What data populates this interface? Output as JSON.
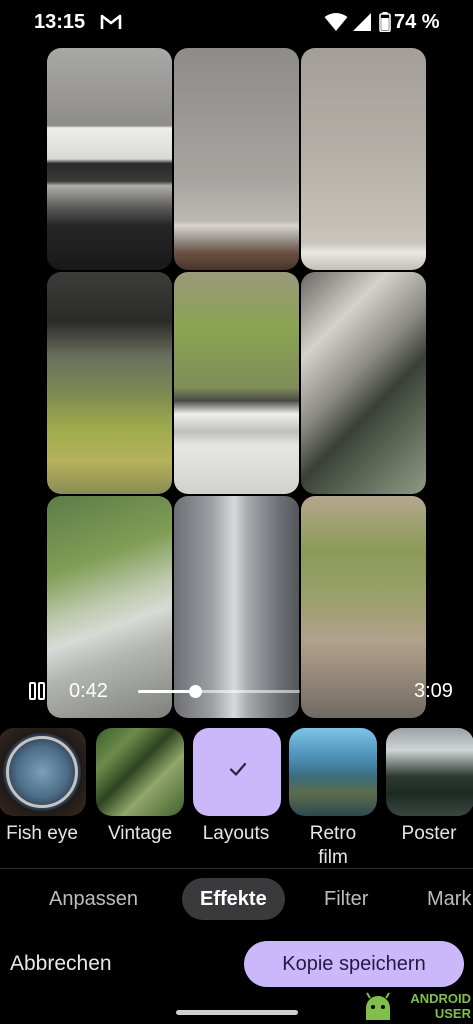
{
  "status_bar": {
    "time": "13:15",
    "battery_pct": "74 %",
    "icons": [
      "gmail-icon",
      "wifi-icon",
      "signal-icon",
      "battery-icon"
    ]
  },
  "player": {
    "current_time": "0:42",
    "total_time": "3:09",
    "progress_fraction": 0.35,
    "state": "playing"
  },
  "effects": [
    {
      "label": "Fish eye"
    },
    {
      "label": "Vintage"
    },
    {
      "label": "Layouts",
      "selected": true
    },
    {
      "label": "Retro film"
    },
    {
      "label": "Poster"
    }
  ],
  "tabs": [
    {
      "label": "Anpassen"
    },
    {
      "label": "Effekte",
      "active": true
    },
    {
      "label": "Filter"
    },
    {
      "label": "Mark"
    }
  ],
  "actions": {
    "cancel_label": "Abbrechen",
    "save_label": "Kopie speichern"
  },
  "watermark": {
    "line1": "ANDROID",
    "line2": "USER"
  },
  "colors": {
    "accent": "#cbb8fb",
    "background": "#000000",
    "active_tab_bg": "#3a3a3c"
  }
}
